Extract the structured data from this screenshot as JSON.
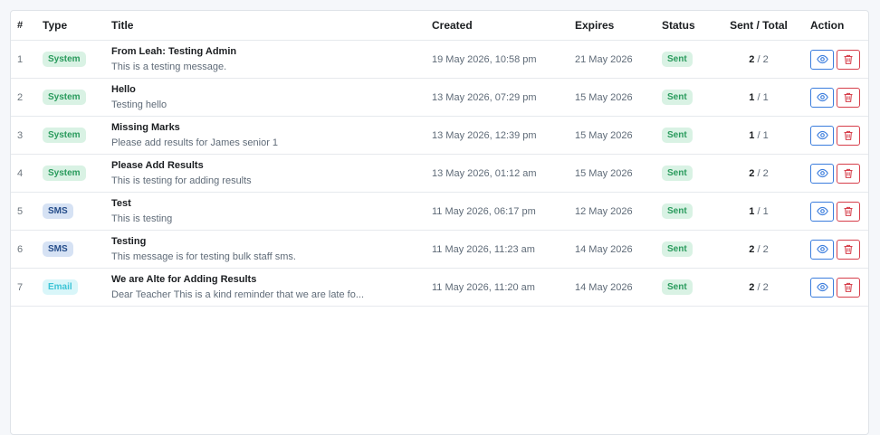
{
  "table": {
    "headers": {
      "num": "#",
      "type": "Type",
      "title": "Title",
      "created": "Created",
      "expires": "Expires",
      "status": "Status",
      "sent_total": "Sent / Total",
      "action": "Action"
    },
    "rows": [
      {
        "num": "1",
        "type": "System",
        "title": "From Leah: Testing Admin",
        "message": "This is a testing message.",
        "created": "19 May 2026, 10:58 pm",
        "expires": "21 May 2026",
        "status": "Sent",
        "sent": "2",
        "total": "/ 2"
      },
      {
        "num": "2",
        "type": "System",
        "title": "Hello",
        "message": "Testing hello",
        "created": "13 May 2026, 07:29 pm",
        "expires": "15 May 2026",
        "status": "Sent",
        "sent": "1",
        "total": "/ 1"
      },
      {
        "num": "3",
        "type": "System",
        "title": "Missing Marks",
        "message": "Please add results for James senior 1",
        "created": "13 May 2026, 12:39 pm",
        "expires": "15 May 2026",
        "status": "Sent",
        "sent": "1",
        "total": "/ 1"
      },
      {
        "num": "4",
        "type": "System",
        "title": "Please Add Results",
        "message": "This is testing for adding results",
        "created": "13 May 2026, 01:12 am",
        "expires": "15 May 2026",
        "status": "Sent",
        "sent": "2",
        "total": "/ 2"
      },
      {
        "num": "5",
        "type": "SMS",
        "title": "Test",
        "message": "This is testing",
        "created": "11 May 2026, 06:17 pm",
        "expires": "12 May 2026",
        "status": "Sent",
        "sent": "1",
        "total": "/ 1"
      },
      {
        "num": "6",
        "type": "SMS",
        "title": "Testing",
        "message": "This message is for testing bulk staff sms.",
        "created": "11 May 2026, 11:23 am",
        "expires": "14 May 2026",
        "status": "Sent",
        "sent": "2",
        "total": "/ 2"
      },
      {
        "num": "7",
        "type": "Email",
        "title": "We are Alte for Adding Results",
        "message": "Dear Teacher This is a kind reminder that we are late fo...",
        "created": "11 May 2026, 11:20 am",
        "expires": "14 May 2026",
        "status": "Sent",
        "sent": "2",
        "total": "/ 2"
      }
    ]
  },
  "icons": {
    "view": "eye-icon",
    "delete": "trash-icon"
  },
  "colors": {
    "system": "#2a9b5d",
    "sms": "#254d8a",
    "email": "#3cc4d6",
    "view": "#3b7ddd",
    "delete": "#d63e4a"
  }
}
